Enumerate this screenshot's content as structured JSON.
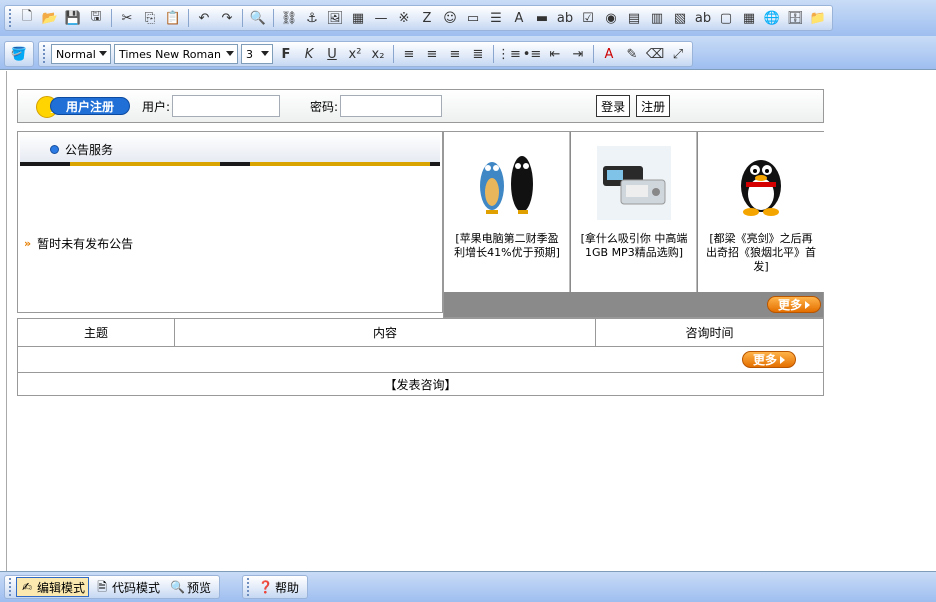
{
  "toolbar_top": {
    "icons": [
      "new-doc-icon",
      "open-folder-icon",
      "save-icon",
      "save-as-icon",
      "cut-icon",
      "copy-icon",
      "paste-icon",
      "undo-icon",
      "redo-icon",
      "find-icon",
      "link-icon",
      "anchor-icon",
      "image-icon",
      "table-icon",
      "hr-icon",
      "special-char-icon",
      "flash-icon",
      "emoticon-icon",
      "form-field-icon",
      "list-box-icon",
      "big-a-icon",
      "text-line-icon",
      "label-box-icon",
      "checkbox-icon",
      "radio-icon",
      "list-icon",
      "grid-icon",
      "text-image-icon",
      "button-icon",
      "box-icon",
      "frame-icon",
      "globe-icon",
      "db-icon",
      "folder-icon"
    ],
    "glyphs": [
      "🗋",
      "📂",
      "💾",
      "🖫",
      "✂",
      "⎘",
      "📋",
      "↶",
      "↷",
      "🔍",
      "⛓",
      "⚓",
      "🖼",
      "▦",
      "—",
      "※",
      "Z",
      "☺",
      "▭",
      "☰",
      "A",
      "▬",
      "ab",
      "☑",
      "◉",
      "▤",
      "▥",
      "▧",
      "ab",
      "▢",
      "▦",
      "🌐",
      "🗄",
      "📁"
    ]
  },
  "toolbar_format": {
    "style_select": "Normal",
    "font_select": "Times New Roman",
    "size_select": "3",
    "buttons": [
      {
        "name": "bold-icon",
        "glyph": "F"
      },
      {
        "name": "italic-icon",
        "glyph": "K"
      },
      {
        "name": "underline-icon",
        "glyph": "U"
      },
      {
        "name": "superscript-icon",
        "glyph": "x²"
      },
      {
        "name": "subscript-icon",
        "glyph": "x₂"
      },
      {
        "name": "align-left-icon",
        "glyph": "≡"
      },
      {
        "name": "align-center-icon",
        "glyph": "≡"
      },
      {
        "name": "align-right-icon",
        "glyph": "≡"
      },
      {
        "name": "justify-icon",
        "glyph": "≣"
      },
      {
        "name": "ordered-list-icon",
        "glyph": "⋮≡"
      },
      {
        "name": "bullet-list-icon",
        "glyph": "•≡"
      },
      {
        "name": "outdent-icon",
        "glyph": "⇤"
      },
      {
        "name": "indent-icon",
        "glyph": "⇥"
      },
      {
        "name": "font-color-icon",
        "glyph": "A"
      },
      {
        "name": "highlight-icon",
        "glyph": "✎"
      },
      {
        "name": "eraser-icon",
        "glyph": "⌫"
      },
      {
        "name": "fullscreen-icon",
        "glyph": "⤢"
      }
    ]
  },
  "register": {
    "logo_text": "用户注册",
    "user_label": "用户:",
    "password_label": "密码:",
    "login_button": "登录",
    "register_button": "注册"
  },
  "notice": {
    "title": "公告服务",
    "empty_text": "暂时未有发布公告",
    "chevron": "»"
  },
  "products": [
    {
      "caption": "[苹果电脑第二财季盈利增长41%优于预期]"
    },
    {
      "caption": "[拿什么吸引你 中高端1GB MP3精品选购]"
    },
    {
      "caption": "[都梁《亮剑》之后再出奇招《狼烟北平》首发]"
    }
  ],
  "more_label": "更多",
  "consult": {
    "col_subject": "主题",
    "col_content": "内容",
    "col_time": "咨询时间",
    "post_link": "【发表咨询】"
  },
  "mode_bar": {
    "edit_mode": "编辑模式",
    "code_mode": "代码模式",
    "preview": "预览",
    "help": "帮助"
  }
}
